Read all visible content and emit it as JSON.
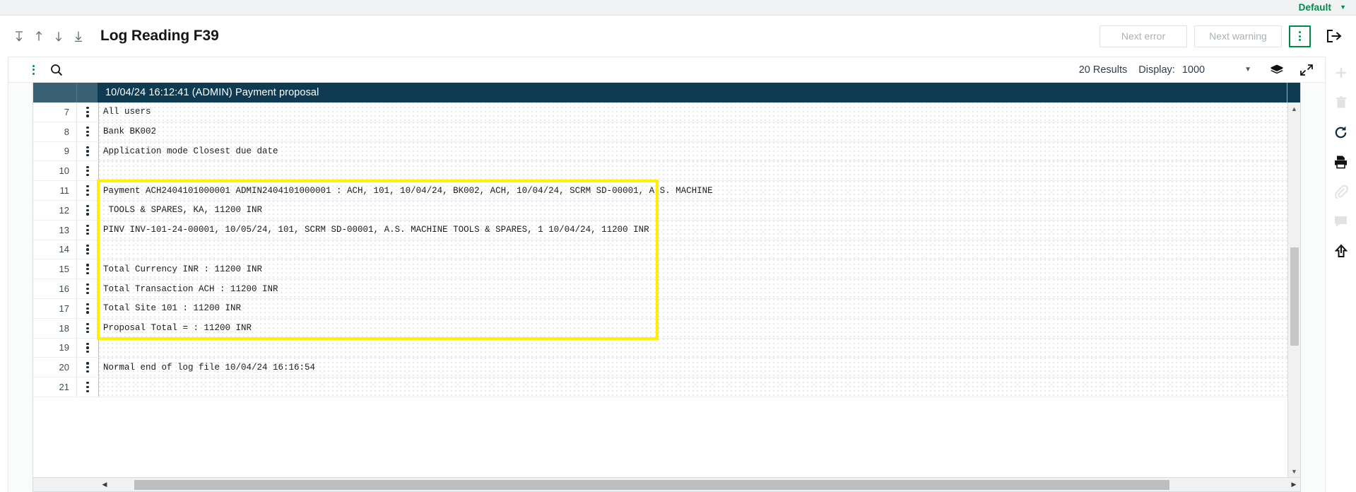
{
  "top_strip": {
    "profile_label": "Default",
    "caret_icon": "chevron-down-icon"
  },
  "header": {
    "title": "Log Reading F39",
    "nav_icons": [
      {
        "name": "go-to-first-icon",
        "glyph": "⤒"
      },
      {
        "name": "go-to-previous-icon",
        "glyph": "↑"
      },
      {
        "name": "go-to-next-icon",
        "glyph": "↓"
      },
      {
        "name": "go-to-last-icon",
        "glyph": "⤓"
      }
    ],
    "next_error_label": "Next error",
    "next_warning_label": "Next warning",
    "kebab_icon": "more-options-icon",
    "exit_icon": "exit-icon"
  },
  "panel_toolbar": {
    "kebab_icon": "panel-menu-icon",
    "search_icon": "search-icon",
    "results_text": "20 Results",
    "display_label": "Display:",
    "display_value": "1000",
    "dropdown_icon": "chevron-down-icon",
    "layers_icon": "layers-icon",
    "expand_icon": "expand-icon"
  },
  "log": {
    "header_title": "10/04/24 16:12:41 (ADMIN) Payment proposal",
    "highlight_color": "#ffef00",
    "rows": [
      {
        "num": "7",
        "text": "All users"
      },
      {
        "num": "8",
        "text": "Bank BK002"
      },
      {
        "num": "9",
        "text": "Application mode Closest due date"
      },
      {
        "num": "10",
        "text": ""
      },
      {
        "num": "11",
        "text": "Payment ACH2404101000001 ADMIN2404101000001 : ACH, 101, 10/04/24, BK002, ACH, 10/04/24, SCRM SD-00001, A.S. MACHINE"
      },
      {
        "num": "12",
        "text": " TOOLS & SPARES, KA, 11200 INR"
      },
      {
        "num": "13",
        "text": "PINV INV-101-24-00001, 10/05/24, 101, SCRM SD-00001, A.S. MACHINE TOOLS & SPARES, 1 10/04/24, 11200 INR"
      },
      {
        "num": "14",
        "text": ""
      },
      {
        "num": "15",
        "text": "Total Currency INR : 11200 INR"
      },
      {
        "num": "16",
        "text": "Total Transaction ACH : 11200 INR"
      },
      {
        "num": "17",
        "text": "Total Site 101 : 11200 INR"
      },
      {
        "num": "18",
        "text": "Proposal Total = : 11200 INR"
      },
      {
        "num": "19",
        "text": ""
      },
      {
        "num": "20",
        "text": "Normal end of log file 10/04/24 16:16:54"
      },
      {
        "num": "21",
        "text": ""
      }
    ],
    "highlight_first_row_index": 4,
    "highlight_last_row_index": 11
  },
  "right_rail": {
    "items": [
      {
        "name": "add-icon",
        "disabled": true
      },
      {
        "name": "delete-icon",
        "disabled": true
      },
      {
        "name": "refresh-icon",
        "disabled": false
      },
      {
        "name": "print-icon",
        "disabled": false
      },
      {
        "name": "attachment-icon",
        "disabled": true
      },
      {
        "name": "comment-icon",
        "disabled": true
      },
      {
        "name": "share-icon",
        "disabled": false
      }
    ]
  },
  "scrollbars": {
    "vertical_up_icon": "caret-up-icon",
    "vertical_down_icon": "caret-down-icon",
    "horizontal_left_icon": "caret-left-icon",
    "horizontal_right_icon": "caret-right-icon"
  }
}
